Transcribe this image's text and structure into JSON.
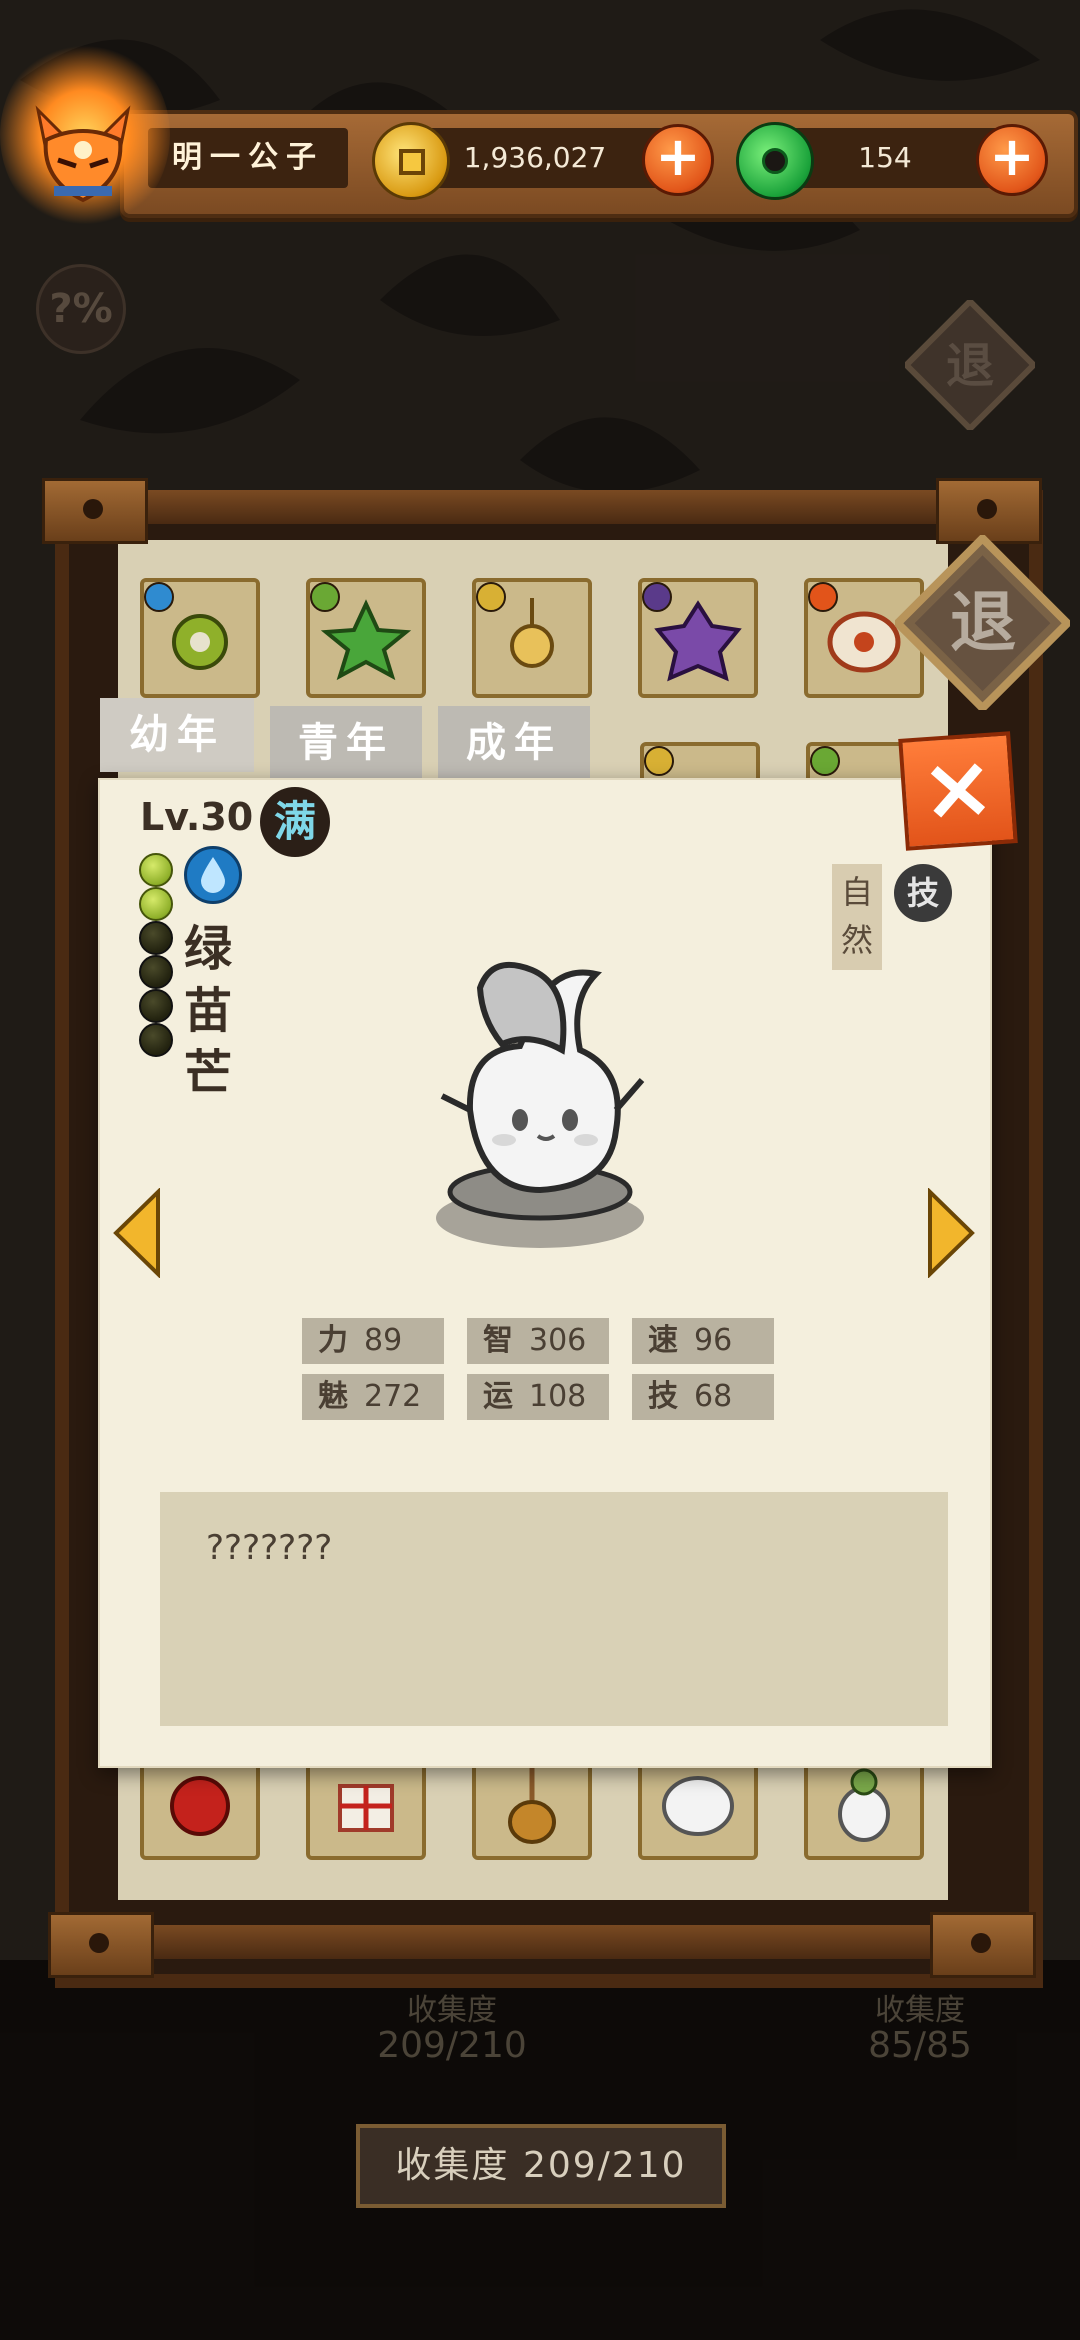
{
  "player": {
    "name": "明一公子"
  },
  "currency": {
    "coins": "1,936,027",
    "jade": "154"
  },
  "buttons": {
    "plus": "+",
    "close": "×",
    "retreat": "退",
    "percent": "?%"
  },
  "tabs": [
    "幼年",
    "青年",
    "成年"
  ],
  "pet": {
    "level": "Lv.30",
    "full_badge": "满",
    "name_chars": [
      "绿",
      "苗",
      "芒"
    ],
    "element": [
      "自",
      "然"
    ],
    "skill_badge": "技",
    "stars_on": 2,
    "stars_total": 6,
    "stats": [
      {
        "label": "力",
        "value": "89"
      },
      {
        "label": "智",
        "value": "306"
      },
      {
        "label": "速",
        "value": "96"
      },
      {
        "label": "魅",
        "value": "272"
      },
      {
        "label": "运",
        "value": "108"
      },
      {
        "label": "技",
        "value": "68"
      }
    ],
    "description": "???????"
  },
  "collection": {
    "label": "收集度 209/210",
    "behind_left": [
      "收集度",
      "209/210"
    ],
    "behind_right": [
      "收集度",
      "85/85"
    ]
  },
  "colors": {
    "accent": "#e2561a",
    "coin": "#f6c840",
    "jade": "#1aa23a",
    "paper": "#f4efdd"
  },
  "icons": {
    "avatar": "fox-mask-icon",
    "coin": "gold-coin-icon",
    "jade": "jade-icon",
    "water": "water-drop-icon",
    "left": "arrow-left-icon",
    "right": "arrow-right-icon"
  }
}
